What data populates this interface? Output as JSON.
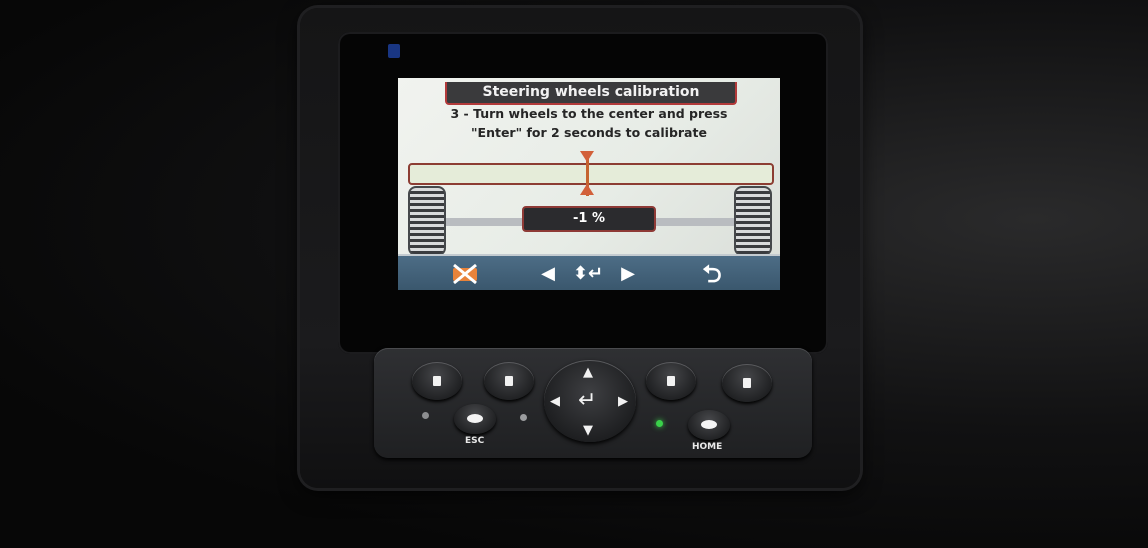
{
  "screen": {
    "title": "Steering wheels calibration",
    "instruction_line1": "3 - Turn wheels to the center and press",
    "instruction_line2": "\"Enter\" for 2 seconds to calibrate",
    "percent_readout": "-1 %",
    "alignment_level_percent": -1,
    "nav": {
      "left_arrow": "◀",
      "enter": "⬍↵",
      "right_arrow": "▶",
      "back": "⮌"
    }
  },
  "keypad": {
    "esc_label": "ESC",
    "home_label": "HOME",
    "dpad": {
      "up": "▲",
      "down": "▼",
      "left": "◀",
      "right": "▶",
      "enter": "↵"
    }
  },
  "colors": {
    "title_bg": "#3a3a3c",
    "accent_red": "#b23a3a",
    "marker": "#d2603a",
    "nav_bar": "#46657d",
    "status_led_green": "#3ad14a",
    "status_led_blue": "#1d3f9a"
  }
}
